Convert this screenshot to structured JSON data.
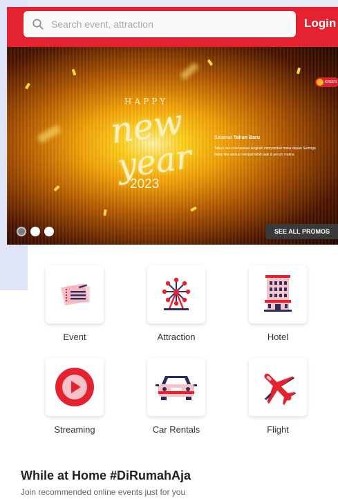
{
  "header": {
    "search_placeholder": "Search event, attraction",
    "login_label": "Login"
  },
  "banner": {
    "happy": "HAPPY",
    "new": "new",
    "year": "year",
    "year_number": "2023",
    "promo_title_prefix": "Selamat ",
    "promo_title_bold": "Tahun Baru",
    "promo_desc": "Tahun baru merupakan langkah menyambut masa depan Semoga hidup kita semua menjadi lebih baik & penuh makna",
    "brand": "KREEN",
    "see_all_label": "SEE ALL PROMOS",
    "slides": 3,
    "active_slide": 1
  },
  "categories": [
    {
      "label": "Event",
      "icon": "ticket-icon"
    },
    {
      "label": "Attraction",
      "icon": "ferris-wheel-icon"
    },
    {
      "label": "Hotel",
      "icon": "hotel-building-icon"
    },
    {
      "label": "Streaming",
      "icon": "play-icon"
    },
    {
      "label": "Car Rentals",
      "icon": "car-icon"
    },
    {
      "label": "Flight",
      "icon": "airplane-icon"
    }
  ],
  "section": {
    "title": "While at Home #DiRumahAja",
    "subtitle": "Join recommended online events just for you"
  },
  "colors": {
    "accent": "#e5222f",
    "tile_shadow": "#d9d9d9",
    "icon_navy": "#2b2f5e"
  }
}
